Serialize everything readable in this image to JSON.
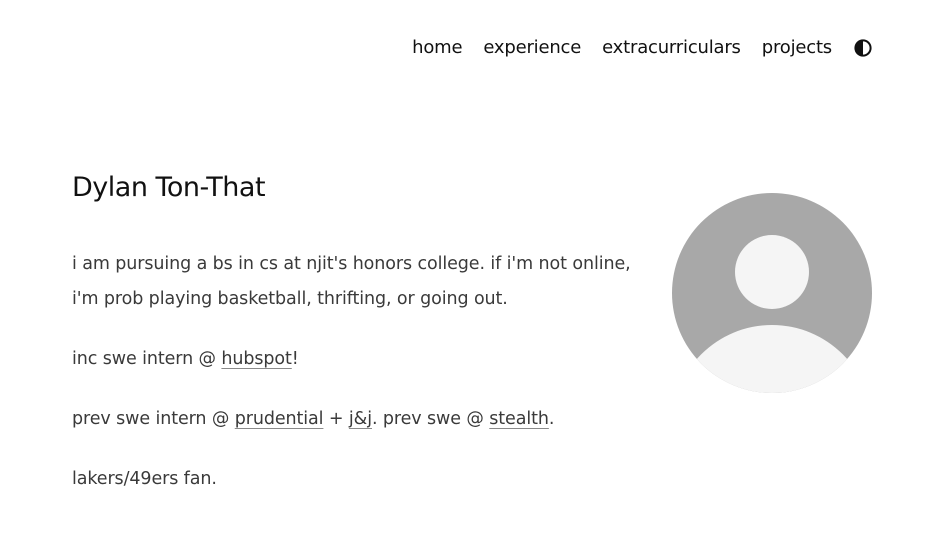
{
  "nav": {
    "items": [
      {
        "label": "home"
      },
      {
        "label": "experience"
      },
      {
        "label": "extracurriculars"
      },
      {
        "label": "projects"
      }
    ],
    "theme_toggle_icon": "contrast-icon"
  },
  "main": {
    "title": "Dylan Ton-That",
    "bio": "i am pursuing a bs in cs at njit's honors college. if i'm not online, i'm prob playing basketball, thrifting, or going out.",
    "current": {
      "prefix": "inc swe intern @ ",
      "company_link": "hubspot",
      "suffix": "!"
    },
    "previous": {
      "prefix": "prev swe intern @ ",
      "link1": "prudential",
      "mid1": " + ",
      "link2": "j&j",
      "mid2": ". prev swe @ ",
      "link3": "stealth",
      "suffix": "."
    },
    "fandom": "lakers/49ers fan."
  },
  "avatar": {
    "icon": "default-avatar-icon",
    "bg_color": "#a8a8a8",
    "figure_color": "#f5f5f5"
  }
}
